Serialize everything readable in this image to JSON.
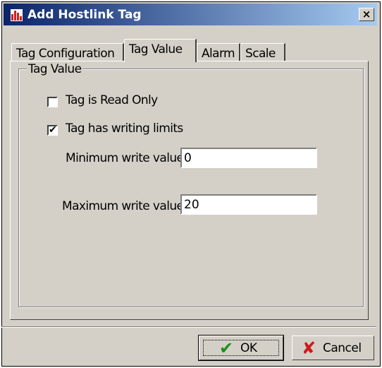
{
  "window": {
    "title": "Add Hostlink Tag",
    "close_glyph": "×"
  },
  "tabs": [
    {
      "label": "Tag Configuration",
      "active": false
    },
    {
      "label": "Tag Value",
      "active": true
    },
    {
      "label": "Alarm",
      "active": false
    },
    {
      "label": "Scale",
      "active": false
    }
  ],
  "group": {
    "title": "Tag Value"
  },
  "checkboxes": [
    {
      "label": "Tag is Read Only",
      "checked": false
    },
    {
      "label": "Tag has writing limits",
      "checked": true
    }
  ],
  "fields": {
    "min": {
      "label": "Minimum write value",
      "value": "0"
    },
    "max": {
      "label": "Maximum write value",
      "value": "20"
    }
  },
  "buttons": {
    "ok": {
      "label": "OK",
      "icon": "checkmark-icon",
      "color": "#1e8f1e"
    },
    "cancel": {
      "label": "Cancel",
      "icon": "red-x-icon",
      "color": "#cc1b1b"
    }
  },
  "icons": {
    "app": "hostlink-app-icon"
  }
}
